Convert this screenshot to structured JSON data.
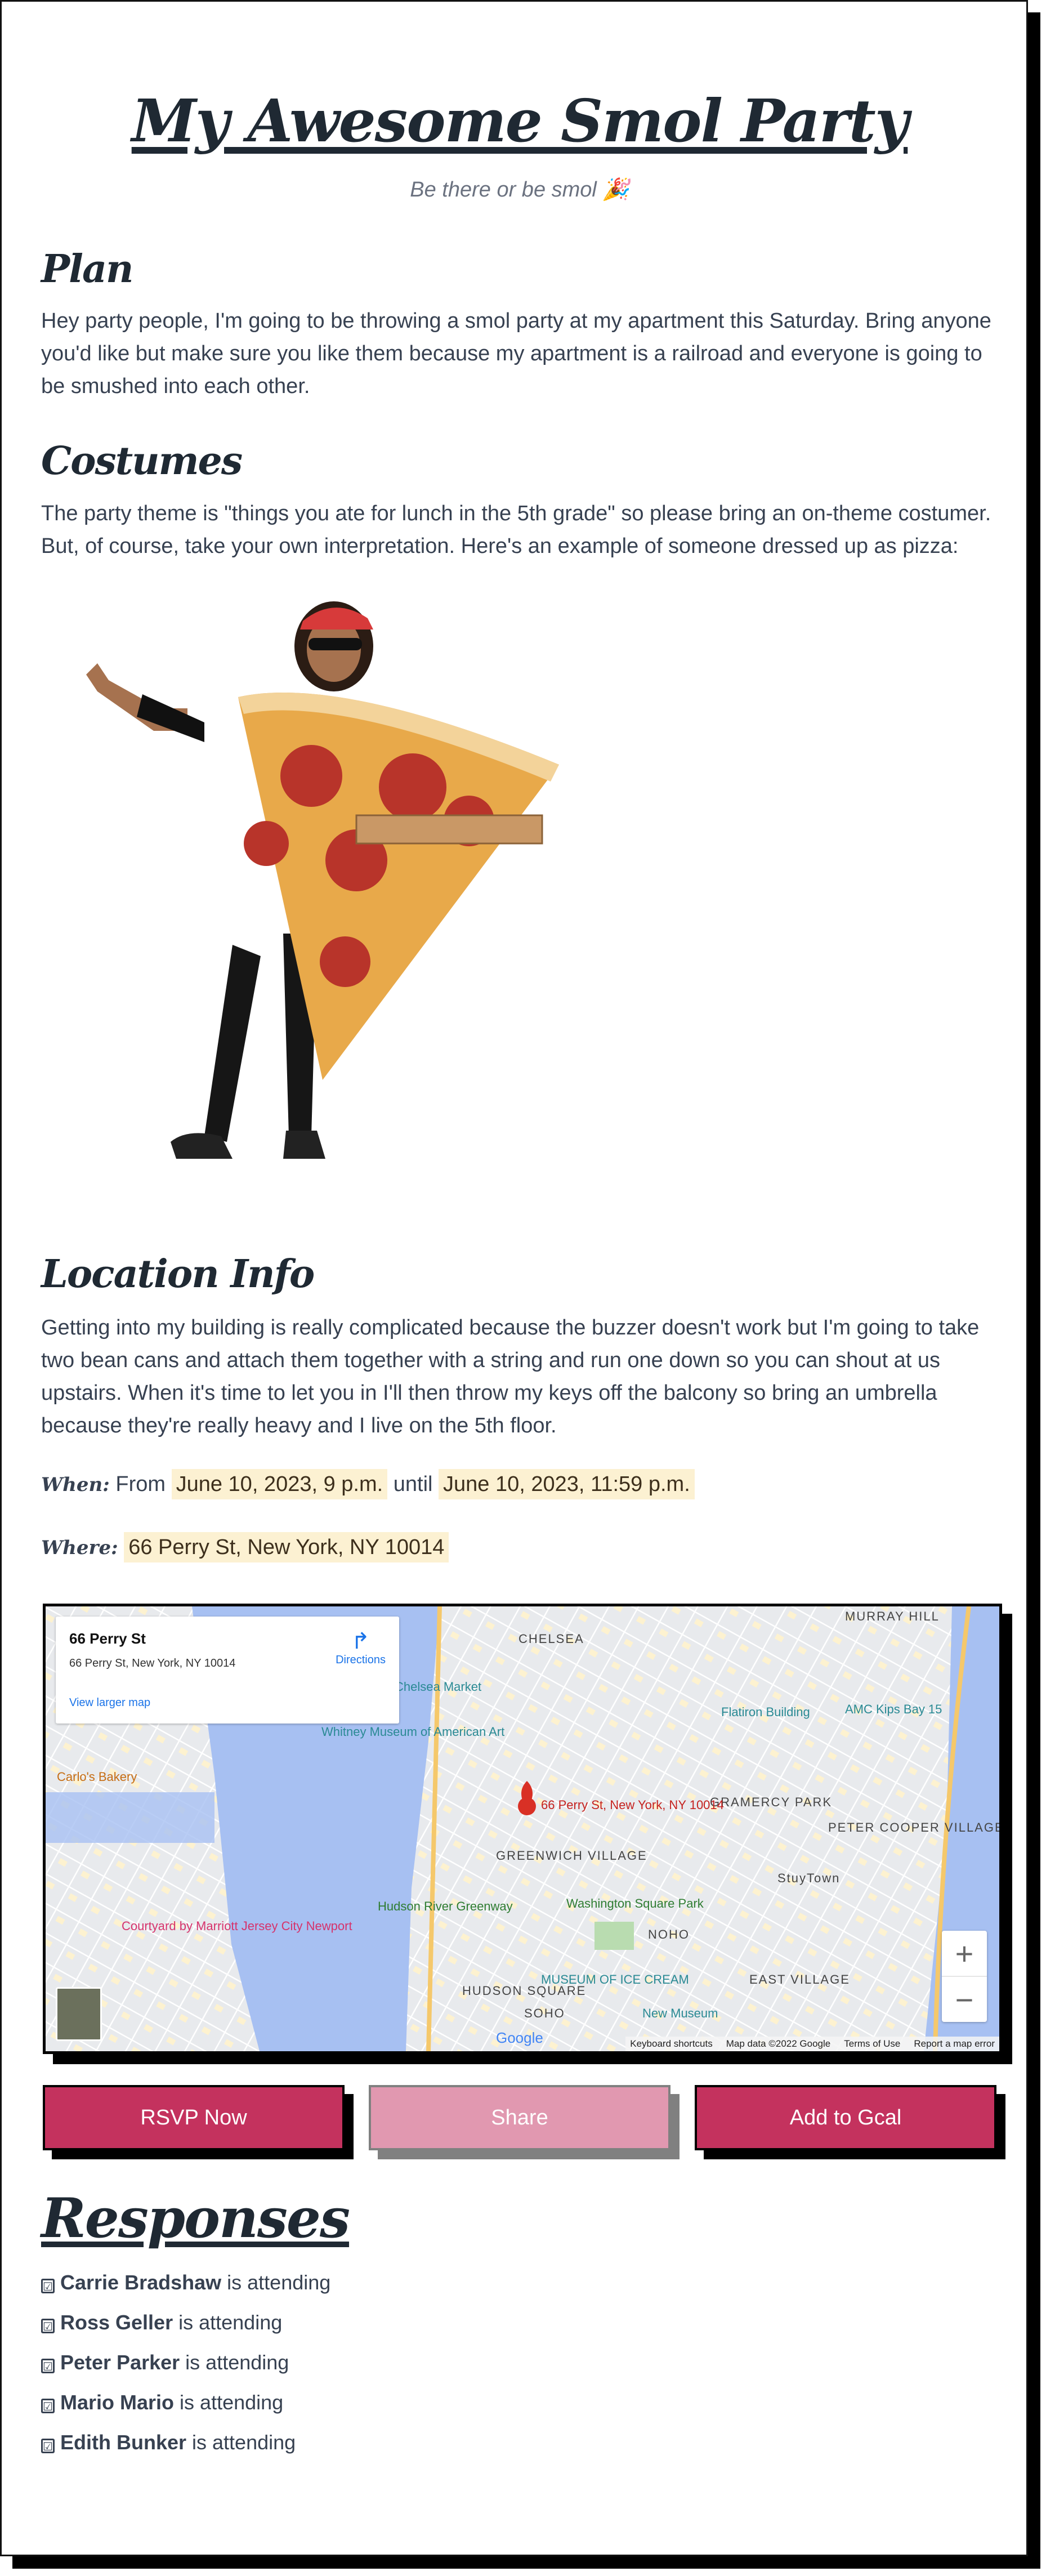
{
  "header": {
    "title": "My Awesome Smol Party",
    "subtitle": "Be there or be smol 🎉"
  },
  "plan": {
    "heading": "Plan",
    "text": "Hey party people, I'm going to be throwing a smol party at my apartment this Saturday. Bring anyone you'd like but make sure you like them because my apartment is a railroad and everyone is going to be smushed into each other."
  },
  "costumes": {
    "heading": "Costumes",
    "text": "The party theme is \"things you ate for lunch in the 5th grade\" so please bring an on-theme costumer. But, of course, take your own interpretation. Here's an example of someone dressed up as pizza:"
  },
  "location": {
    "heading": "Location Info",
    "text": "Getting into my building is really complicated because the buzzer doesn't work but I'm going to take two bean cans and attach them together with a string and run one down so you can shout at us upstairs. When it's time to let you in I'll then throw my keys off the balcony so bring an umbrella because they're really heavy and I live on the 5th floor."
  },
  "when": {
    "label": "When:",
    "from_word": "From",
    "start": "June 10, 2023, 9 p.m.",
    "until_word": "until",
    "end": "June 10, 2023, 11:59 p.m."
  },
  "where": {
    "label": "Where:",
    "address": "66 Perry St, New York, NY 10014"
  },
  "map": {
    "card_title": "66 Perry St",
    "card_address": "66 Perry St, New York, NY 10014",
    "directions": "Directions",
    "larger_map": "View larger map",
    "pin_label": "66 Perry St, New York, NY 10014",
    "labels": [
      "CHELSEA",
      "MURRAY HILL",
      "GRAMERCY PARK",
      "PETER COOPER VILLAGE",
      "GREENWICH VILLAGE",
      "NOHO",
      "EAST VILLAGE",
      "SOHO",
      "HUDSON SQUARE",
      "StuyTown"
    ],
    "pois": [
      "Flatiron Building",
      "AMC Kips Bay 15",
      "Whitney Museum of American Art",
      "Chelsea Market",
      "Carlo's Bakery",
      "Washington Square Park",
      "Hudson River Greenway",
      "MUSEUM OF ICE CREAM",
      "New Museum",
      "Courtyard by Marriott Jersey City Newport"
    ],
    "zoom_in": "+",
    "zoom_out": "−",
    "attribution": [
      "Keyboard shortcuts",
      "Map data ©2022 Google",
      "Terms of Use",
      "Report a map error"
    ],
    "google": "Google"
  },
  "buttons": {
    "rsvp": "RSVP Now",
    "share": "Share",
    "gcal": "Add to Gcal"
  },
  "responses": {
    "heading": "Responses",
    "suffix": "is attending",
    "checkbox": "☑",
    "items": [
      {
        "name": "Carrie Bradshaw"
      },
      {
        "name": "Ross Geller"
      },
      {
        "name": "Peter Parker"
      },
      {
        "name": "Mario Mario"
      },
      {
        "name": "Edith Bunker"
      }
    ]
  },
  "colors": {
    "primary": "#c4325e",
    "muted": "#e198b0",
    "highlight": "#fcf1d2"
  }
}
